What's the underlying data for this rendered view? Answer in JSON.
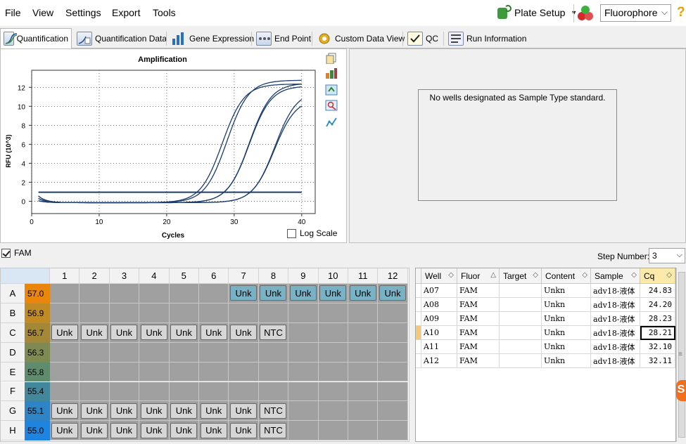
{
  "menu": [
    "File",
    "View",
    "Settings",
    "Export",
    "Tools"
  ],
  "toolbar": {
    "plate_setup": "Plate Setup",
    "fluorophore": "Fluorophore",
    "help": "?"
  },
  "tabs": [
    "Quantification",
    "Quantification Data",
    "Gene Expression",
    "End Point",
    "Custom Data View",
    "QC",
    "Run Information"
  ],
  "standard_message": "No wells designated as Sample Type standard.",
  "log_scale_label": "Log Scale",
  "fluor_filter": "FAM",
  "step_number": {
    "label": "Step Number:",
    "value": "3"
  },
  "chart_data": {
    "type": "line",
    "title": "Amplification",
    "xlabel": "Cycles",
    "ylabel": "RFU (10^3)",
    "xlim": [
      0,
      42
    ],
    "ylim": [
      -1.3,
      13.8
    ],
    "x_ticks": [
      0,
      10,
      20,
      30,
      40
    ],
    "y_ticks": [
      0,
      2,
      4,
      6,
      8,
      10,
      12
    ],
    "grid": true,
    "threshold": 0.95,
    "line_color": "#1b3d6e",
    "series": [
      {
        "cq": 24.83,
        "plateau": 12.9
      },
      {
        "cq": 24.2,
        "plateau": 12.5
      },
      {
        "cq": 28.23,
        "plateau": 12.3
      },
      {
        "cq": 28.21,
        "plateau": 12.6
      },
      {
        "cq": 32.1,
        "plateau": 11.8
      },
      {
        "cq": 32.11,
        "plateau": 11.0
      }
    ]
  },
  "plate": {
    "columns": [
      "1",
      "2",
      "3",
      "4",
      "5",
      "6",
      "7",
      "8",
      "9",
      "10",
      "11",
      "12"
    ],
    "rows": [
      {
        "label": "A",
        "temp": "57.0",
        "color": "#e8870c",
        "wells": [
          "",
          "",
          "",
          "",
          "",
          "",
          "Unk",
          "Unk",
          "Unk",
          "Unk",
          "Unk",
          "Unk"
        ],
        "teal_from": 6
      },
      {
        "label": "B",
        "temp": "56.9",
        "color": "#c08a24",
        "wells": [
          "",
          "",
          "",
          "",
          "",
          "",
          "",
          "",
          "",
          "",
          "",
          ""
        ]
      },
      {
        "label": "C",
        "temp": "56.7",
        "color": "#a48838",
        "wells": [
          "Unk",
          "Unk",
          "Unk",
          "Unk",
          "Unk",
          "Unk",
          "Unk",
          "NTC",
          "",
          "",
          "",
          ""
        ]
      },
      {
        "label": "D",
        "temp": "56.3",
        "color": "#7f8a52",
        "wells": [
          "",
          "",
          "",
          "",
          "",
          "",
          "",
          "",
          "",
          "",
          "",
          ""
        ]
      },
      {
        "label": "E",
        "temp": "55.8",
        "color": "#5f8c6c",
        "wells": [
          "",
          "",
          "",
          "",
          "",
          "",
          "",
          "",
          "",
          "",
          "",
          ""
        ]
      },
      {
        "label": "F",
        "temp": "55.4",
        "color": "#42889c",
        "wells": [
          "",
          "",
          "",
          "",
          "",
          "",
          "",
          "",
          "",
          "",
          "",
          ""
        ]
      },
      {
        "label": "G",
        "temp": "55.1",
        "color": "#2e84c4",
        "wells": [
          "Unk",
          "Unk",
          "Unk",
          "Unk",
          "Unk",
          "Unk",
          "Unk",
          "NTC",
          "",
          "",
          "",
          ""
        ]
      },
      {
        "label": "H",
        "temp": "55.0",
        "color": "#1e84e0",
        "wells": [
          "Unk",
          "Unk",
          "Unk",
          "Unk",
          "Unk",
          "Unk",
          "Unk",
          "NTC",
          "",
          "",
          "",
          ""
        ]
      }
    ]
  },
  "table": {
    "headers": [
      "Well",
      "Fluor",
      "Target",
      "Content",
      "Sample",
      "Cq"
    ],
    "rows": [
      [
        "A07",
        "FAM",
        "",
        "Unkn",
        "adv18-液体",
        "24.83"
      ],
      [
        "A08",
        "FAM",
        "",
        "Unkn",
        "adv18-液体",
        "24.20"
      ],
      [
        "A09",
        "FAM",
        "",
        "Unkn",
        "adv18-液体",
        "28.23"
      ],
      [
        "A10",
        "FAM",
        "",
        "Unkn",
        "adv18-液体",
        "28.21"
      ],
      [
        "A11",
        "FAM",
        "",
        "Unkn",
        "adv18-液体",
        "32.10"
      ],
      [
        "A12",
        "FAM",
        "",
        "Unkn",
        "adv18-液体",
        "32.11"
      ]
    ],
    "selected_row": 3
  }
}
